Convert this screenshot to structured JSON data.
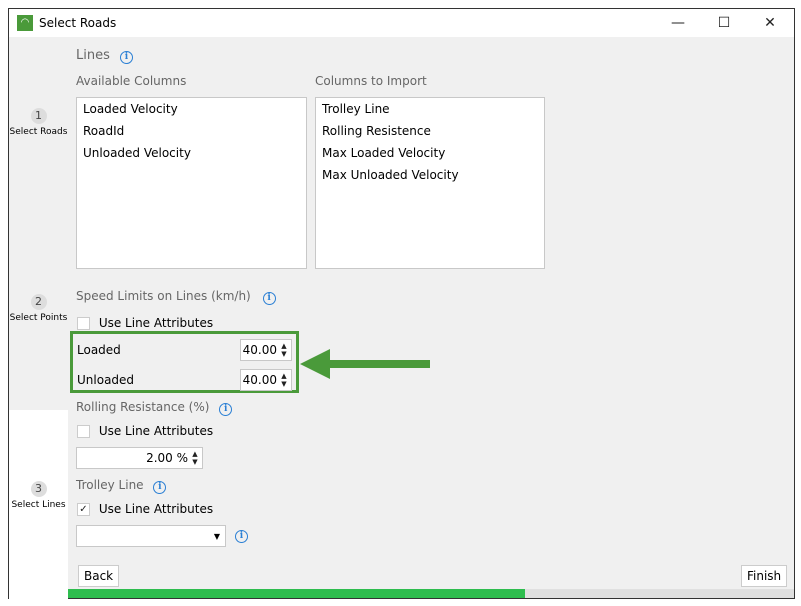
{
  "window": {
    "title": "Select Roads",
    "minimize": "—",
    "maximize": "☐",
    "close": "✕"
  },
  "steps": [
    {
      "num": "1",
      "label": "Select Roads"
    },
    {
      "num": "2",
      "label": "Select Points"
    },
    {
      "num": "3",
      "label": "Select Lines"
    }
  ],
  "lines": {
    "title": "Lines",
    "available_label": "Available Columns",
    "import_label": "Columns to Import",
    "available": [
      "Loaded Velocity",
      "RoadId",
      "Unloaded Velocity"
    ],
    "to_import": [
      "Trolley Line",
      "Rolling Resistence",
      "Max Loaded Velocity",
      "Max Unloaded Velocity"
    ]
  },
  "speed": {
    "title": "Speed Limits on Lines (km/h)",
    "use_attr": "Use Line Attributes",
    "use_attr_checked": false,
    "loaded_label": "Loaded",
    "loaded_value": "40.00",
    "unloaded_label": "Unloaded",
    "unloaded_value": "40.00"
  },
  "rolling": {
    "title": "Rolling Resistance (%)",
    "use_attr": "Use Line Attributes",
    "use_attr_checked": false,
    "value": "2.00 %"
  },
  "trolley": {
    "title": "Trolley Line",
    "use_attr": "Use Line Attributes",
    "use_attr_checked": true,
    "select_value": ""
  },
  "buttons": {
    "back": "Back",
    "finish": "Finish"
  },
  "progress": {
    "percent": 63
  },
  "colors": {
    "highlight": "#4a9a3a",
    "progress": "#2ebd4e"
  }
}
